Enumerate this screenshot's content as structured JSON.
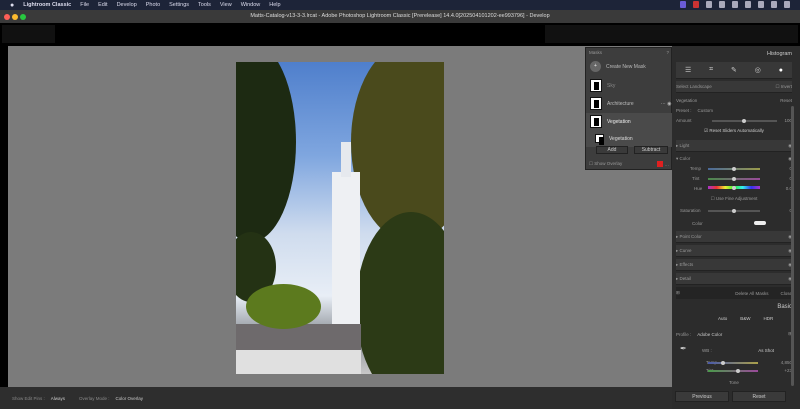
{
  "menubar": {
    "items": [
      "Lightroom Classic",
      "File",
      "Edit",
      "Develop",
      "Photo",
      "Settings",
      "Tools",
      "View",
      "Window",
      "Help"
    ]
  },
  "window": {
    "title": "Matts-Catalog-v13-3-3.lrcat - Adobe Photoshop Lightroom Classic [Prerelease] 14.4.0[202504101202-ee993796] - Develop"
  },
  "masks": {
    "title": "Masks",
    "create": "Create New Mask",
    "items": [
      "Sky",
      "Architecture",
      "Vegetation"
    ],
    "sub_item": "Vegetation",
    "add": "Add",
    "subtract": "Subtract",
    "show_overlay": "Show Overlay",
    "overlay_color": "#e02020"
  },
  "right": {
    "histogram": "Histogram",
    "select": "Select Landscape",
    "invert": "Invert",
    "mask_name": "Vegetation",
    "reset": "Reset",
    "preset_label": "Preset :",
    "preset_value": "Custom",
    "amount_label": "Amount",
    "amount_value": "100",
    "reset_sliders": "Reset Sliders Automatically",
    "light": "Light",
    "color": "Color",
    "temp": "Temp",
    "temp_value": "0",
    "tint": "Tint",
    "tint_value": "0",
    "hue": "Hue",
    "hue_value": "0.0",
    "fine": "Use Fine Adjustment",
    "saturation": "Saturation",
    "saturation_value": "0",
    "color_label": "Color",
    "sections": [
      "Point Color",
      "Curve",
      "Effects",
      "Detail"
    ],
    "delete_all": "Delete All Masks",
    "close": "Close",
    "basic": "Basic",
    "auto": "Auto",
    "bw": "B&W",
    "hdr": "HDR",
    "profile_label": "Profile :",
    "profile_value": "Adobe Color",
    "wb_label": "WB :",
    "wb_value": "As Shot",
    "basic_temp": "Temp",
    "basic_temp_value": "4,850",
    "basic_tint": "Tint",
    "basic_tint_value": "+23",
    "tone": "Tone",
    "previous": "Previous",
    "reset_button": "Reset"
  },
  "toolbar": {
    "show_edit_pins_label": "Show Edit Pins :",
    "show_edit_pins_value": "Always",
    "overlay_mode_label": "Overlay Mode :",
    "overlay_mode_value": "Color Overlay"
  }
}
